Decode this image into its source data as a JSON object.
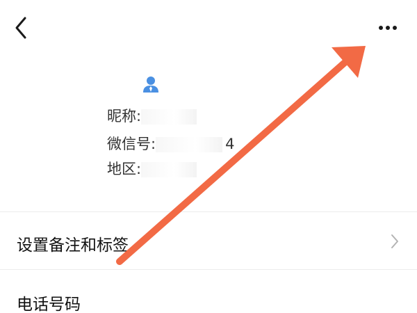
{
  "header": {
    "back_icon": "chevron-left-icon",
    "more_icon": "more-dots-icon"
  },
  "profile": {
    "contact_icon": "contact-person-icon",
    "nickname_label": "昵称:",
    "wechat_id_label": "微信号:",
    "wechat_id_visible_tail": "4",
    "region_label": "地区:"
  },
  "menu": {
    "remark_label": "设置备注和标签",
    "phone_label": "电话号码"
  },
  "annotation": {
    "arrow_color": "#f26a45"
  },
  "colors": {
    "icon_blue": "#4a90e2",
    "chevron_gray": "#b3b3b3"
  }
}
